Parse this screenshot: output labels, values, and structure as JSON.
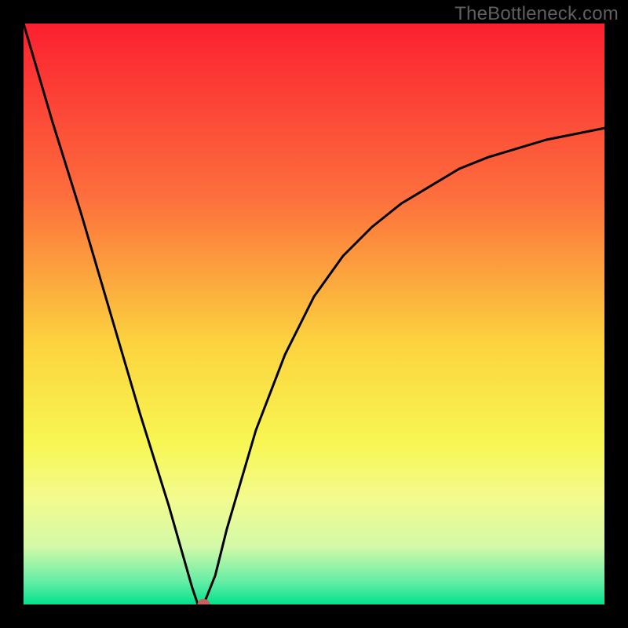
{
  "watermark": "TheBottleneck.com",
  "chart_data": {
    "type": "line",
    "title": "",
    "xlabel": "",
    "ylabel": "",
    "xlim": [
      0,
      100
    ],
    "ylim": [
      0,
      100
    ],
    "grid": false,
    "series": [
      {
        "name": "curve",
        "x": [
          0,
          5,
          10,
          15,
          20,
          25,
          27,
          29,
          30,
          31,
          33,
          35,
          40,
          45,
          50,
          55,
          60,
          65,
          70,
          75,
          80,
          85,
          90,
          95,
          100
        ],
        "values": [
          100,
          83,
          67,
          50,
          33,
          17,
          10,
          3,
          0,
          0,
          5,
          13,
          30,
          43,
          53,
          60,
          65,
          69,
          72,
          75,
          77,
          78.5,
          80,
          81,
          82
        ]
      }
    ],
    "marker": {
      "x": 31,
      "y": 0,
      "color": "#c9605a"
    },
    "gradient_stops": [
      {
        "offset": 0,
        "color": "#fb2030"
      },
      {
        "offset": 0.3,
        "color": "#fd6f3d"
      },
      {
        "offset": 0.55,
        "color": "#fcd33e"
      },
      {
        "offset": 0.72,
        "color": "#f8f652"
      },
      {
        "offset": 0.82,
        "color": "#f3fb8f"
      },
      {
        "offset": 0.9,
        "color": "#d3f9a8"
      },
      {
        "offset": 0.96,
        "color": "#66eea6"
      },
      {
        "offset": 1.0,
        "color": "#02e18d"
      }
    ]
  }
}
